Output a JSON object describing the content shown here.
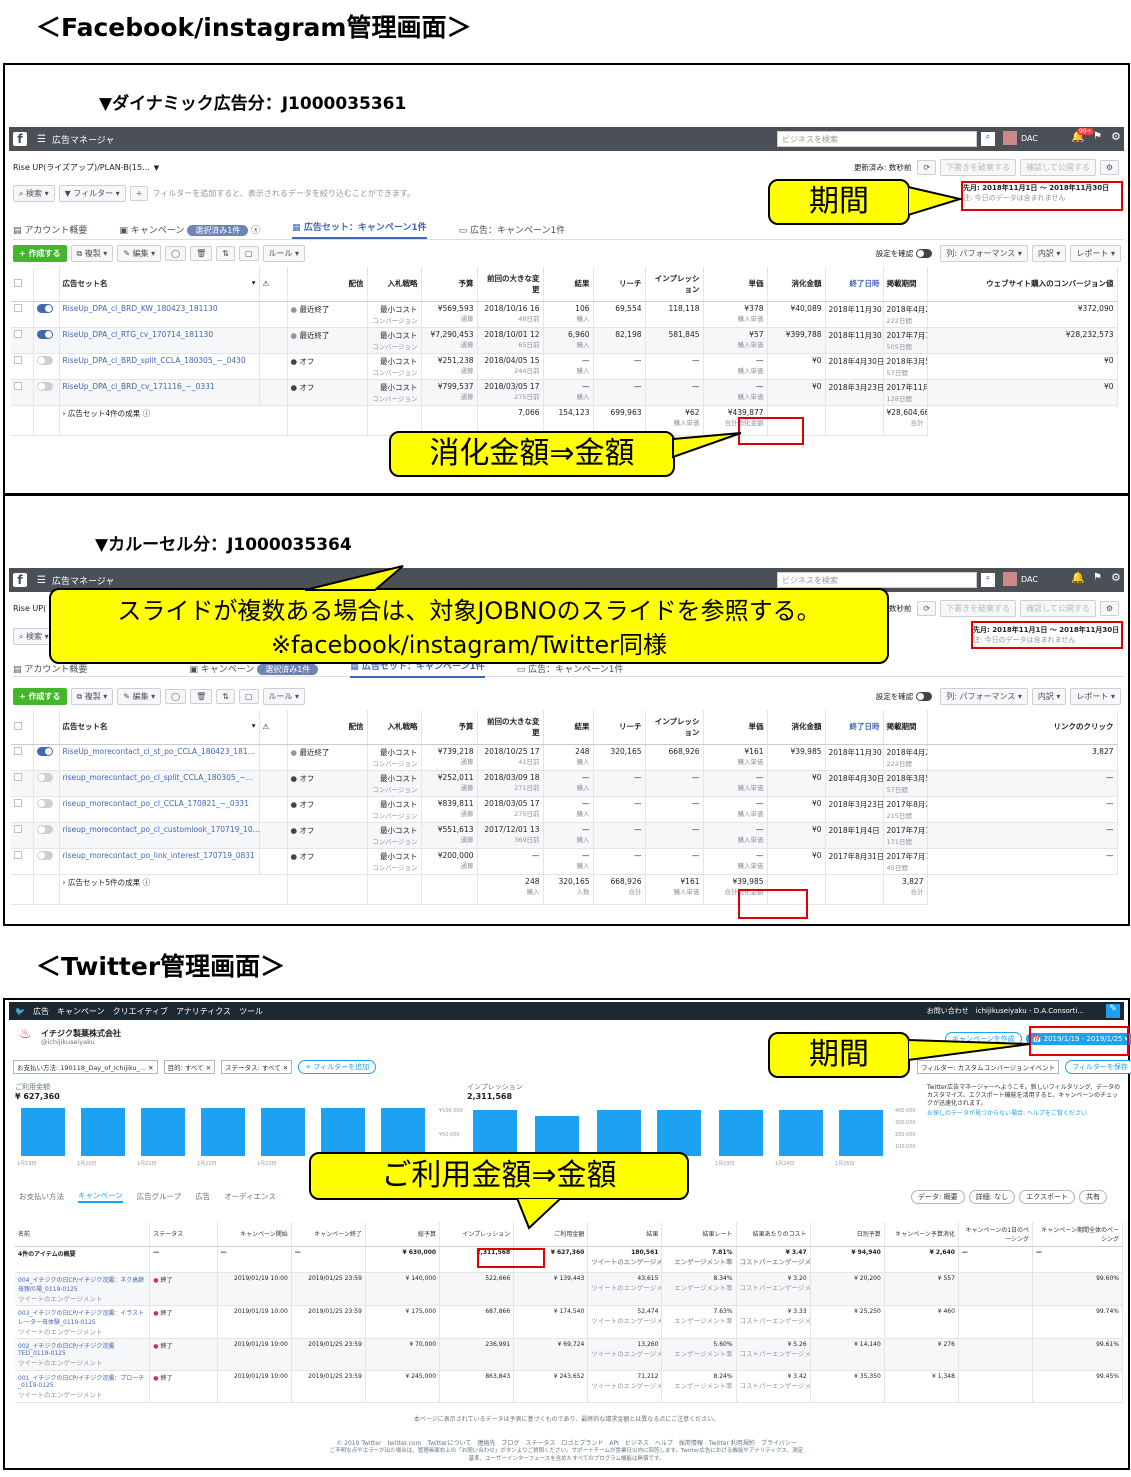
{
  "headings": {
    "fb": "＜Facebook/instagram管理画面＞",
    "tw": "＜Twitter管理画面＞"
  },
  "dyn": {
    "label": "▼ダイナミック広告分：J1000035361",
    "nav": {
      "menu": "広告マネージャ",
      "search": "ビジネスを検索",
      "user": "DAC",
      "notif": "99+"
    },
    "account": "Rise UP(ライズアップ)/PLAN-B(15...",
    "updated": "更新済み: 数秒前",
    "discard": "下書きを破棄する",
    "publish": "確認して公開する",
    "search_label": "検索",
    "filter_label": "フィルター",
    "filter_hint": "フィルターを追加すると、表示されるデータを絞り込むことができます。",
    "period": "先月: 2018年11月1日 ～ 2018年11月30日",
    "period_note": "注: 今日のデータは含まれません",
    "tabs": {
      "account": "アカウント概要",
      "campaign": "キャンペーン",
      "selected": "選択済み1件",
      "adset": "広告セット：キャンペーン1件",
      "ad": "広告：キャンペーン1件"
    },
    "toolbar": {
      "create": "+ 作成する",
      "dup": "複製",
      "edit": "編集",
      "rules": "ルール",
      "settings": "設定を確認",
      "cols": "列: パフォーマンス",
      "breakdown": "内訳",
      "reports": "レポート"
    },
    "headers": [
      "広告セット名",
      "配信",
      "入札戦略",
      "予算",
      "前回の大きな変更",
      "結果",
      "リーチ",
      "インプレッション",
      "単価",
      "消化金額",
      "終了日時",
      "掲載期間",
      "ウェブサイト購入のコンバージョン値"
    ],
    "rows": [
      {
        "name": "RiseUp_DPA_cl_BRD_KW_180423_181130",
        "status": "最近終了",
        "bid": "最小コスト",
        "bid2": "コンバージョン",
        "budget": "¥569,593",
        "budget2": "通算",
        "change": "2018/10/16 16",
        "change2": "48日前",
        "results": "106",
        "results2": "購入",
        "reach": "69,554",
        "imp": "118,118",
        "cpr": "¥378",
        "cpr2": "購入単価",
        "spend": "¥40,089",
        "end": "2018年11月30日",
        "sched": "2018年4月23日 ～ 2018年11月30日",
        "sched2": "222日間",
        "value": "¥372,090"
      },
      {
        "name": "RiseUp_DPA_cl_RTG_cv_170714_181130",
        "status": "最近終了",
        "bid": "最小コスト",
        "bid2": "コンバージョン",
        "budget": "¥7,290,453",
        "budget2": "通算",
        "change": "2018/10/01 12",
        "change2": "65日前",
        "results": "6,960",
        "results2": "購入",
        "reach": "82,198",
        "imp": "581,845",
        "cpr": "¥57",
        "cpr2": "購入単価",
        "spend": "¥399,788",
        "end": "2018年11月30日",
        "sched": "2017年7月14日 ～ 2018年11月30日",
        "sched2": "505日間",
        "value": "¥28,232,573"
      },
      {
        "name": "RiseUp_DPA_cl_BRD_split_CCLA_180305_~_0430",
        "status": "オフ",
        "bid": "最小コスト",
        "bid2": "コンバージョン",
        "budget": "¥251,238",
        "budget2": "通算",
        "change": "2018/04/05 15",
        "change2": "244日前",
        "results": "—",
        "results2": "購入",
        "reach": "—",
        "imp": "—",
        "cpr": "—",
        "cpr2": "購入単価",
        "spend": "¥0",
        "end": "2018年4月30日",
        "sched": "2018年3月5日 ～ 2018年4月30日",
        "sched2": "57日間",
        "value": "¥0"
      },
      {
        "name": "RiseUp_DPA_cl_BRD_cv_171116_~_0331",
        "status": "オフ",
        "bid": "最小コスト",
        "bid2": "コンバージョン",
        "budget": "¥799,537",
        "budget2": "通算",
        "change": "2018/03/05 17",
        "change2": "275日前",
        "results": "—",
        "results2": "購入",
        "reach": "—",
        "imp": "—",
        "cpr": "—",
        "cpr2": "購入単価",
        "spend": "¥0",
        "end": "2018年3月23日",
        "sched": "2017年11月16日 ～ 2018年3月23日",
        "sched2": "128日間",
        "value": "¥0"
      }
    ],
    "total": {
      "name": "広告セット4件の成果",
      "results": "7,066",
      "reach": "154,123",
      "imp": "699,963",
      "cpr": "¥62",
      "cpr2": "購入単価",
      "spend": "¥439,877",
      "spend2": "合計消化金額",
      "value": "¥28,604,663",
      "value2": "合計"
    },
    "callout_period": "期間",
    "callout_spend": "消化金額⇒金額"
  },
  "car": {
    "label": "▼カルーセル分：J1000035364",
    "account": "Rise UP(",
    "updated": "更新済み: 数秒前",
    "headers": [
      "広告セット名",
      "配信",
      "入札戦略",
      "予算",
      "前回の大きな変更",
      "結果",
      "リーチ",
      "インプレッション",
      "単価",
      "消化金額",
      "終了日時",
      "掲載期間",
      "リンクのクリック"
    ],
    "rows": [
      {
        "name": "RiseUp_morecontact_cl_st_po_CCLA_180423_181...",
        "on": true,
        "status": "最近終了",
        "bid": "最小コスト",
        "bid2": "コンバージョン",
        "budget": "¥739,218",
        "budget2": "通算",
        "change": "2018/10/25 17",
        "change2": "41日前",
        "results": "248",
        "results2": "購入",
        "reach": "320,165",
        "imp": "668,926",
        "cpr": "¥161",
        "cpr2": "購入単価",
        "spend": "¥39,985",
        "end": "2018年11月30日",
        "sched": "2018年4月23日 ～ 2018年11月30日",
        "sched2": "222日間",
        "value": "3,827"
      },
      {
        "name": "riseup_morecontact_po_cl_split_CCLA_180305_~...",
        "on": false,
        "status": "オフ",
        "bid": "最小コスト",
        "bid2": "コンバージョン",
        "budget": "¥252,011",
        "budget2": "通算",
        "change": "2018/03/09 18",
        "change2": "271日前",
        "results": "—",
        "results2": "購入",
        "reach": "—",
        "imp": "—",
        "cpr": "—",
        "cpr2": "購入単価",
        "spend": "¥0",
        "end": "2018年4月30日",
        "sched": "2018年3月5日 ～ 2018年4月30日",
        "sched2": "57日間",
        "value": "—"
      },
      {
        "name": "riseup_morecontact_po_cl_CCLA_170821_~_0331",
        "on": false,
        "status": "オフ",
        "bid": "最小コスト",
        "bid2": "コンバージョン",
        "budget": "¥839,811",
        "budget2": "通算",
        "change": "2018/03/05 17",
        "change2": "275日前",
        "results": "—",
        "results2": "購入",
        "reach": "—",
        "imp": "—",
        "cpr": "—",
        "cpr2": "購入単価",
        "spend": "¥0",
        "end": "2018年3月23日",
        "sched": "2017年8月21日 ～ 2018年3月23日",
        "sched2": "215日間",
        "value": "—"
      },
      {
        "name": "riseup_morecontact_po_cl_customlook_170719_10...",
        "on": false,
        "status": "オフ",
        "bid": "最小コスト",
        "bid2": "コンバージョン",
        "budget": "¥551,613",
        "budget2": "通算",
        "change": "2017/12/01 13",
        "change2": "369日前",
        "results": "—",
        "results2": "購入",
        "reach": "—",
        "imp": "—",
        "cpr": "—",
        "cpr2": "購入単価",
        "spend": "¥0",
        "end": "2018年1月4日",
        "sched": "2017年7月18日 ～ 2018年1月4日",
        "sched2": "171日間",
        "value": "—"
      },
      {
        "name": "riseup_morecontact_po_link_interest_170719_0831",
        "on": false,
        "status": "オフ",
        "bid": "最小コスト",
        "bid2": "コンバージョン",
        "budget": "¥200,000",
        "budget2": "通算",
        "change": "—",
        "change2": "",
        "results": "—",
        "results2": "購入",
        "reach": "—",
        "imp": "—",
        "cpr": "—",
        "cpr2": "購入単価",
        "spend": "¥0",
        "end": "2017年8月31日",
        "sched": "2017年7月18日 ～ 2017年8月31日",
        "sched2": "45日間",
        "value": "—"
      }
    ],
    "total": {
      "name": "広告セット5件の成果",
      "results": "248",
      "results2": "購入",
      "reach": "320,165",
      "reach2": "人数",
      "imp": "668,926",
      "imp2": "合計",
      "cpr": "¥161",
      "cpr2": "購入単価",
      "spend": "¥39,985",
      "spend2": "合計消化金額",
      "value": "3,827",
      "value2": "合計"
    },
    "callout": "スライドが複数ある場合は、対象JOBNOのスライドを参照する。\n※facebook/instagram/Twitter同様"
  },
  "tw": {
    "nav": [
      "広告",
      "キャンペーン",
      "クリエイティブ",
      "アナリティクス",
      "ツール"
    ],
    "nav_right": "お問い合わせ　ichijikuseiyaku - D.A.Consorti...",
    "company": "イチジク製薬株式会社",
    "handle": "@ichijikuseiyaku",
    "filters": [
      "お支払い方法: 190118_Day_of_Ichijiku_...",
      "目的: すべて",
      "ステータス: すべて"
    ],
    "add_filter": "+ フィルターを追加",
    "create": "キャンペーンを作成",
    "date": "2019/1/19 - 2019/1/25",
    "filter2": "フィルター: カスタムコンバージョンイベント",
    "save": "フィルターを保存",
    "spend_label": "ご利用金額",
    "spend_value": "¥ 627,360",
    "imp_label": "インプレッション",
    "imp_value": "2,311,568",
    "axis_left": [
      "¥100,000",
      "¥50,000"
    ],
    "axis_right": [
      "400,000",
      "300,000",
      "200,000",
      "100,000"
    ],
    "days": [
      "1月19日",
      "1月20日",
      "1月21日",
      "1月22日",
      "1月23日",
      "1月24日",
      "1月25日"
    ],
    "notice": "Twitter広告マネージャーへようこそ。新しいフィルタリング、データのカスタマイズ、エクスポート機能を活用すると、キャンペーンのチェックが迅速化されます。",
    "notice2": "お探しのデータが見つからない場合: ヘルプをご覧ください",
    "tabs": [
      "お支払い方法",
      "キャンペーン",
      "広告グループ",
      "広告",
      "オーディエンス"
    ],
    "btns": [
      "データ: 概要",
      "詳細: なし",
      "エクスポート",
      "共有"
    ],
    "headers": [
      "名前",
      "ステータス",
      "キャンペーン開始",
      "キャンペーン終了",
      "総予算",
      "インプレッション",
      "ご利用金額",
      "結果",
      "結果レート",
      "結果あたりのコスト",
      "日別予算",
      "キャンペーン予算消化",
      "キャンペーンの1日のペーシング",
      "キャンペーン期間全体のペーシング"
    ],
    "summary": {
      "name": "4件のアイテムの概要",
      "budget": "¥ 630,000",
      "imp": "2,311,568",
      "spend": "¥ 627,360",
      "results": "180,561",
      "results2": "ツイートのエンゲージメント",
      "rate": "7.81%",
      "rate2": "エンゲージメント率",
      "cost": "¥ 3.47",
      "cost2": "コストパーエンゲージメント",
      "daily": "¥ 94,940",
      "budgetUsed": "¥ 2,640"
    },
    "rows": [
      {
        "name": "004_イチジクの日CP/イチジク浣腸：ネク高齢母親の場_0119-0125",
        "sub": "ツイートのエンゲージメント",
        "status": "終了",
        "start": "2019/01/19 10:00",
        "end": "2019/01/25 23:59",
        "budget": "¥ 140,000",
        "imp": "522,666",
        "spend": "¥ 139,443",
        "results": "43,615",
        "rate": "8.34%",
        "cost": "¥ 3.20",
        "daily": "¥ 20,200",
        "used": "¥ 557",
        "pace": "99.60%"
      },
      {
        "name": "003_イチジクの日CP/イチジク浣腸：イラストレーター母体験_0119-0125",
        "sub": "ツイートのエンゲージメント",
        "status": "終了",
        "start": "2019/01/19 10:00",
        "end": "2019/01/25 23:59",
        "budget": "¥ 175,000",
        "imp": "687,866",
        "spend": "¥ 174,540",
        "results": "52,474",
        "rate": "7.63%",
        "cost": "¥ 3.33",
        "daily": "¥ 25,250",
        "used": "¥ 460",
        "pace": "99.74%"
      },
      {
        "name": "002_イチジクの日CP/イチジク浣腸TED_0119-0125",
        "sub": "ツイートのエンゲージメント",
        "status": "終了",
        "start": "2019/01/19 10:00",
        "end": "2019/01/25 23:59",
        "budget": "¥ 70,000",
        "imp": "236,991",
        "spend": "¥ 69,724",
        "results": "13,260",
        "rate": "5.60%",
        "cost": "¥ 5.26",
        "daily": "¥ 14,140",
        "used": "¥ 276",
        "pace": "99.61%"
      },
      {
        "name": "001_イチジクの日CP/イチジク浣腸：プローチ_0119-0125",
        "sub": "ツイートのエンゲージメント",
        "status": "終了",
        "start": "2019/01/19 10:00",
        "end": "2019/01/25 23:59",
        "budget": "¥ 245,000",
        "imp": "863,843",
        "spend": "¥ 243,652",
        "results": "71,212",
        "rate": "8.24%",
        "cost": "¥ 3.42",
        "daily": "¥ 35,350",
        "used": "¥ 1,348",
        "pace": "99.45%"
      }
    ],
    "footer1": "本ページに表示されているデータは予測に基づくものであり、最終的な請求金額とは異なる点にご注意ください。",
    "footer2": "© 2019 Twitter　twitter.com　Twitterについて　連絡先　ブログ　ステータス　ロゴとブランド　API　ビジネス　ヘルプ　採用情報　Twitter 利用規約　プライバシー",
    "footer3": "ご不明な点やエラーが出た場合は、管理画面右上の「お問い合わせ」ボタンよりご質問ください。サポートチームが営業日以内に回答します。Twitter広告における機能やアナリティクス、測定",
    "footer4": "基準、ユーザーインターフェースを含めたすべてのプログラム機能は無償です。",
    "callout_period": "期間",
    "callout_spend": "ご利用金額⇒金額"
  }
}
